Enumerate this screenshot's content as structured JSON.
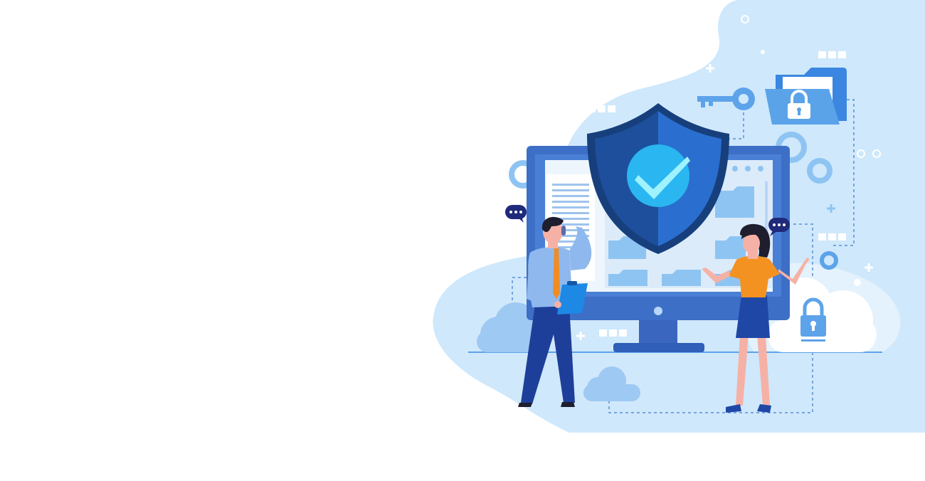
{
  "colors": {
    "background": "#ffffff",
    "blob": "#cfe8fb",
    "blob_light": "#e3f2fd",
    "monitor_frame": "#4a7fd6",
    "monitor_dark": "#2f5fb8",
    "screen": "#eef6fd",
    "shield_dark": "#1d4f9c",
    "shield_mid": "#2a6fcf",
    "shield_border": "#173f7c",
    "check_circle": "#2ab6f0",
    "check": "#9ff3ff",
    "folder": "#8ec4f2",
    "folder_front": "#5aa3e8",
    "accent_blue": "#5da3ea",
    "speech_bubble": "#1f2a7a",
    "man_shirt": "#8fb9ee",
    "man_pants": "#1e3f99",
    "man_tie": "#f08c23",
    "woman_shirt": "#f39221",
    "woman_skirt": "#1f47a6",
    "skin": "#f6b1a6",
    "hair": "#1e1e2e"
  },
  "icons": [
    "security-shield-icon",
    "checkmark-icon",
    "key-icon",
    "locked-folder-icon",
    "cloud-lock-icon",
    "gear-icon",
    "speech-bubble-icon",
    "cloud-icon",
    "clipboard-icon"
  ]
}
